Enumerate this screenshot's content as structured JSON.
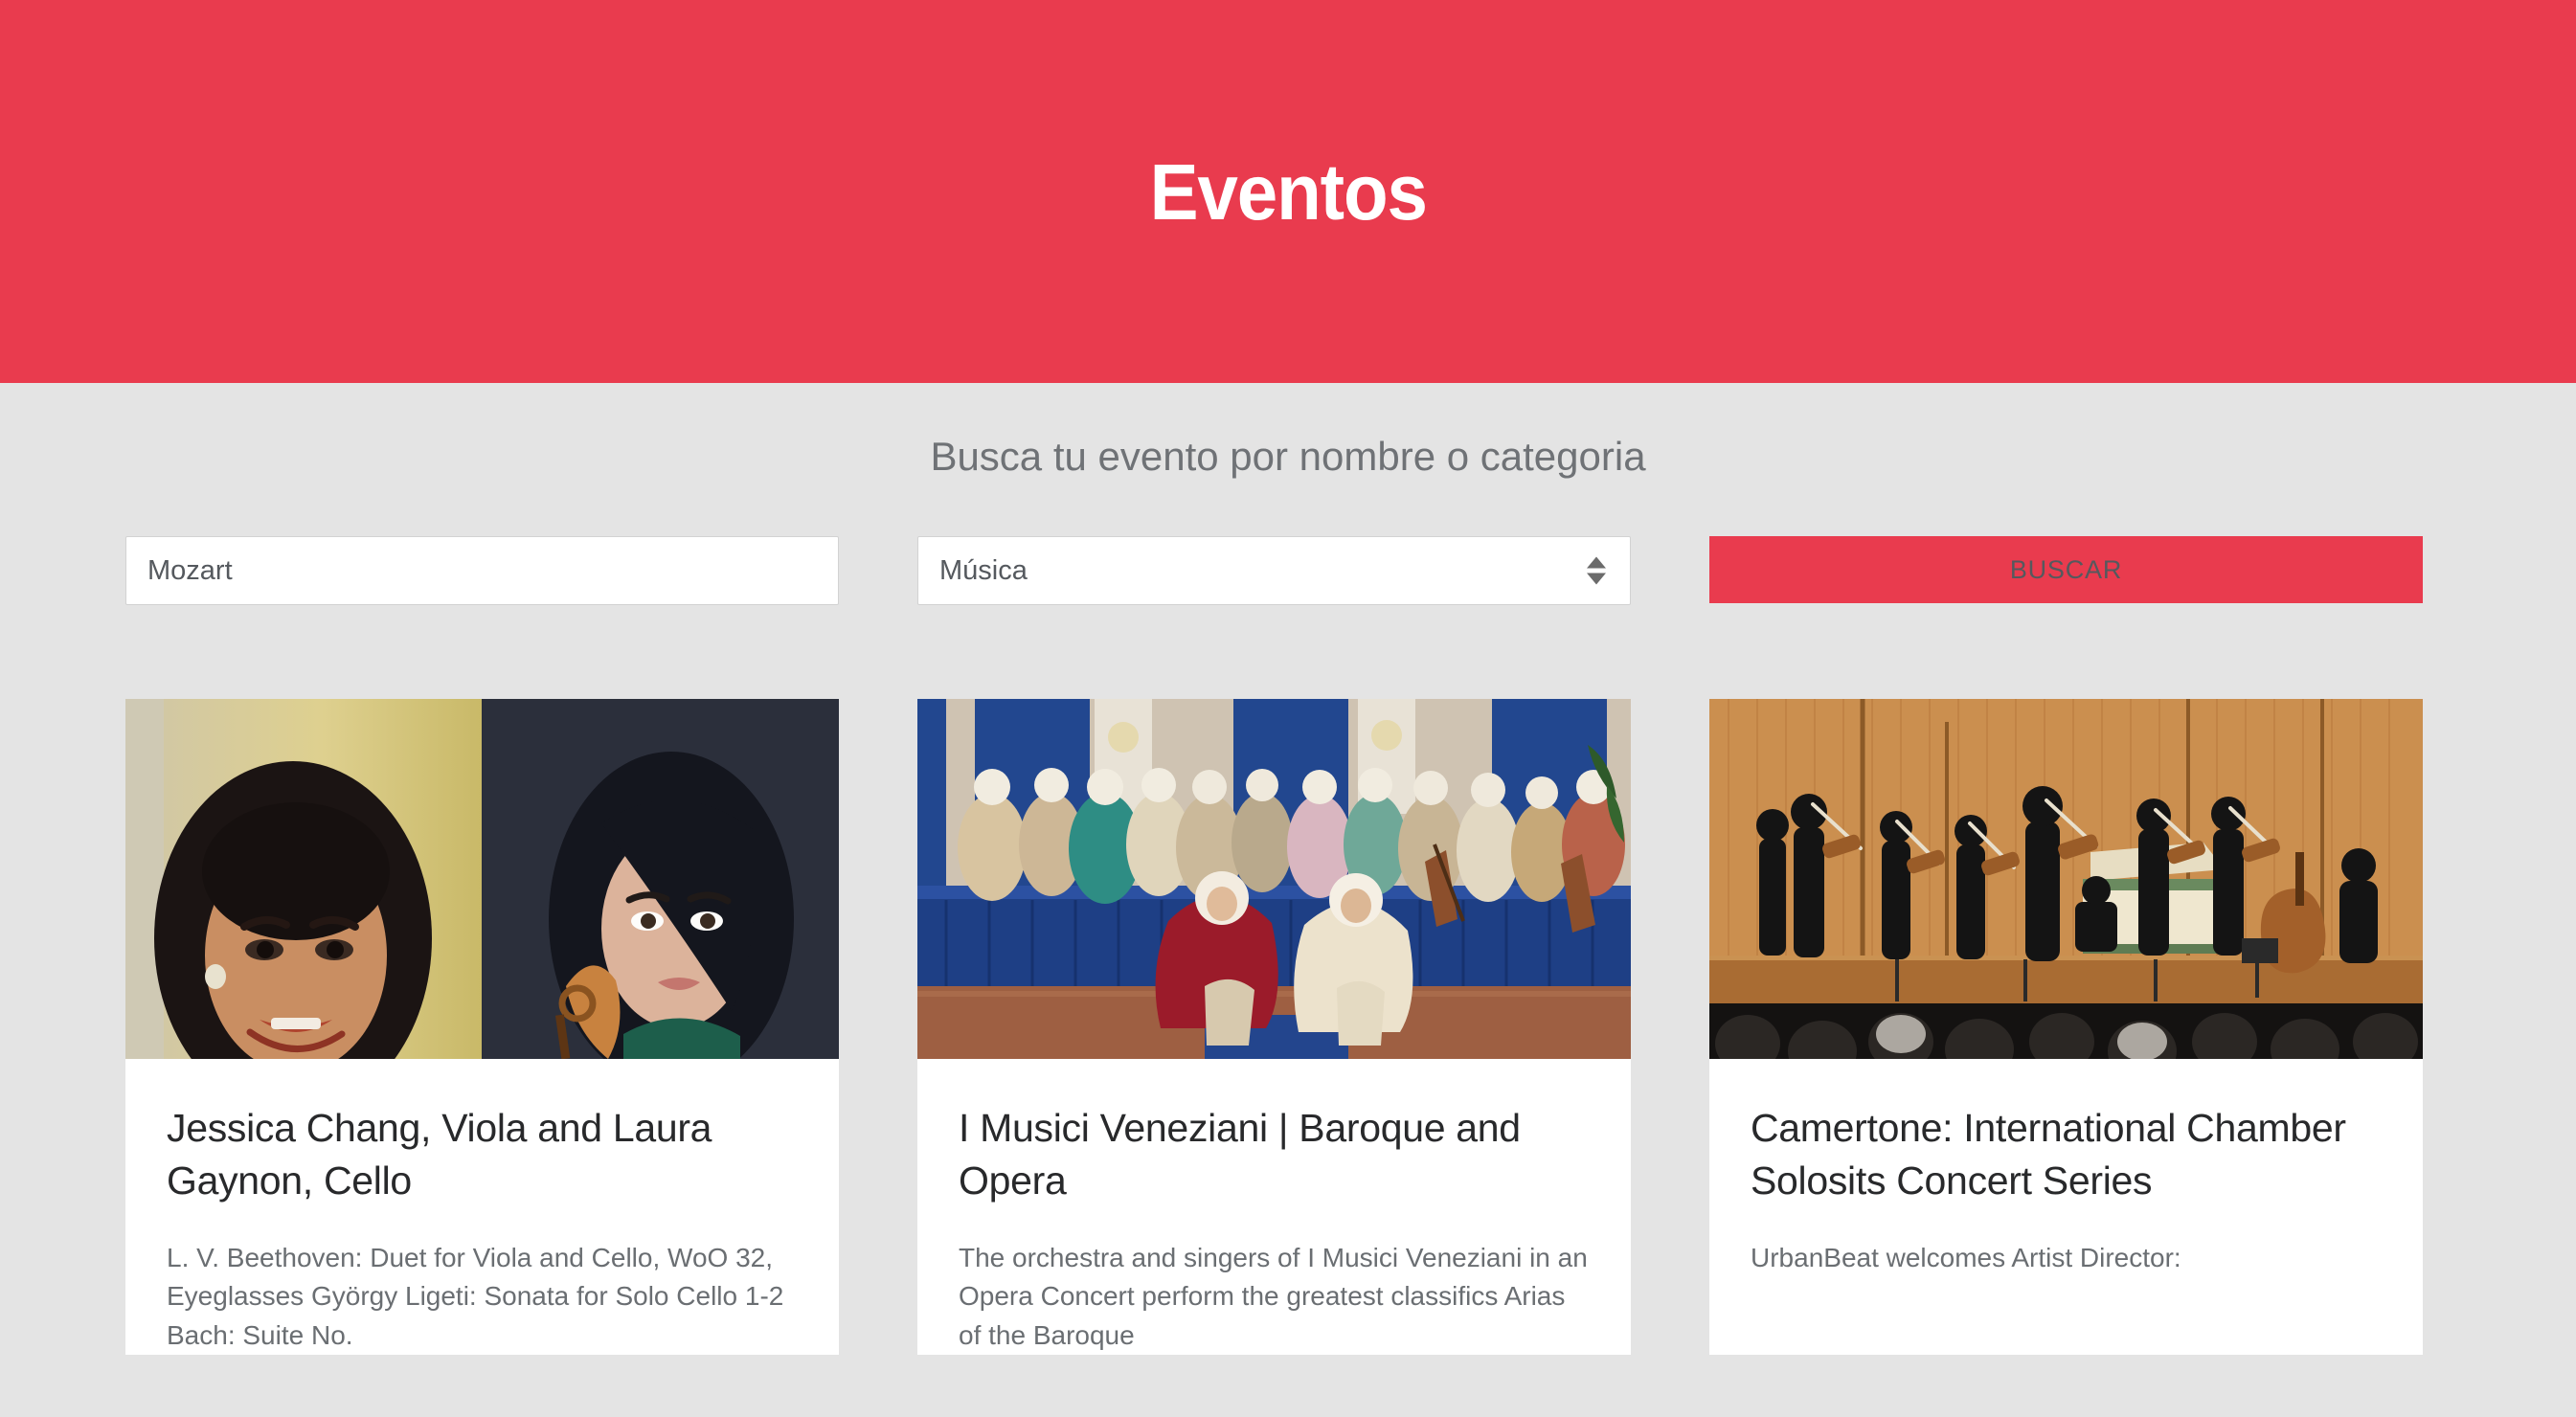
{
  "header": {
    "title": "Eventos",
    "background_color": "#e93b4e",
    "title_color": "#ffffff"
  },
  "search": {
    "prompt": "Busca tu evento por nombre o categoria",
    "name_input": {
      "value": "Mozart",
      "placeholder": "Mozart"
    },
    "category_select": {
      "value": "Música",
      "options": [
        "Música"
      ]
    },
    "submit_label": "BUSCAR",
    "submit_color": "#e93b4e"
  },
  "results": {
    "cards": [
      {
        "title": "Jessica Chang, Viola and Laura Gaynon, Cello",
        "description": "L. V. Beethoven: Duet for Viola and Cello, WoO 32, Eyeglasses György Ligeti: Sonata for Solo Cello 1-2 Bach: Suite No.",
        "image_alt": "two-portrait-musicians-photo"
      },
      {
        "title": "I Musici Veneziani | Baroque and Opera",
        "description": "The orchestra and singers of I Musici Veneziani in an Opera Concert  perform the greatest classifics Arias of the Baroque",
        "image_alt": "baroque-costumed-ensemble-photo"
      },
      {
        "title": "Camertone: International Chamber Solosits Concert Series",
        "description": "UrbanBeat welcomes Artist Director:",
        "image_alt": "chamber-orchestra-on-stage-photo"
      }
    ]
  }
}
